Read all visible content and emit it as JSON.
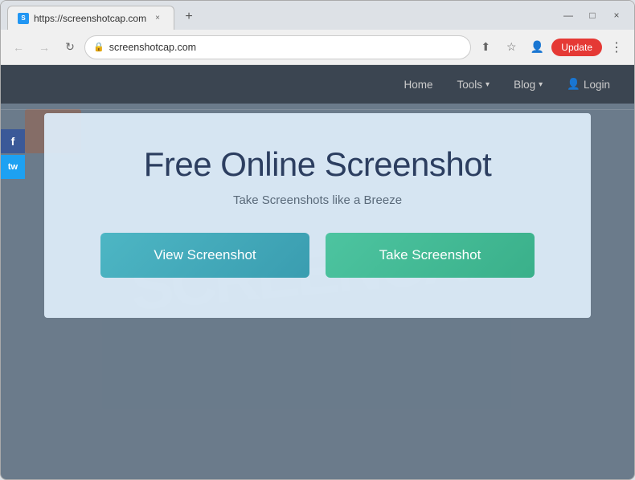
{
  "browser": {
    "tab": {
      "favicon": "S",
      "title": "https://screenshotcap.com",
      "close_label": "×"
    },
    "new_tab_label": "+",
    "window_controls": {
      "minimize": "—",
      "maximize": "□",
      "close": "×"
    },
    "nav": {
      "back": "←",
      "forward": "→",
      "reload": "↻"
    },
    "url": {
      "lock_icon": "🔒",
      "text": "screenshotcap.com"
    },
    "address_actions": {
      "share": "⬆",
      "bookmark": "☆",
      "account": "👤",
      "update_label": "Update",
      "more": "⋮"
    }
  },
  "site": {
    "nav": {
      "home": "Home",
      "tools": "Tools",
      "tools_arrow": "▾",
      "blog": "Blog",
      "blog_arrow": "▾",
      "login_icon": "👤",
      "login": "Login"
    },
    "social": {
      "facebook": "f",
      "twitter": "tw"
    }
  },
  "hero": {
    "title": "Free Online Screenshot",
    "subtitle": "Take Screenshots like a Breeze",
    "view_btn": "View Screenshot",
    "take_btn": "Take Screenshot"
  },
  "colors": {
    "view_btn_start": "#4db6c4",
    "view_btn_end": "#3a9db0",
    "take_btn_start": "#4dc4a0",
    "take_btn_end": "#3ab08a",
    "title_color": "#2c3e60",
    "bg_color": "#dce8f4"
  }
}
